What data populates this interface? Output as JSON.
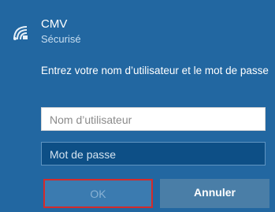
{
  "network": {
    "icon": "wifi-secured-icon",
    "name": "CMV",
    "status": "Sécurisé"
  },
  "prompt": "Entrez votre nom d’utilisateur et le mot de passe",
  "username": {
    "value": "",
    "placeholder": "Nom d’utilisateur"
  },
  "password": {
    "value": "",
    "placeholder": "Mot de passe"
  },
  "buttons": {
    "ok_label": "OK",
    "cancel_label": "Annuler"
  },
  "colors": {
    "background": "#2267a1",
    "highlight_border": "#d42b2b"
  }
}
